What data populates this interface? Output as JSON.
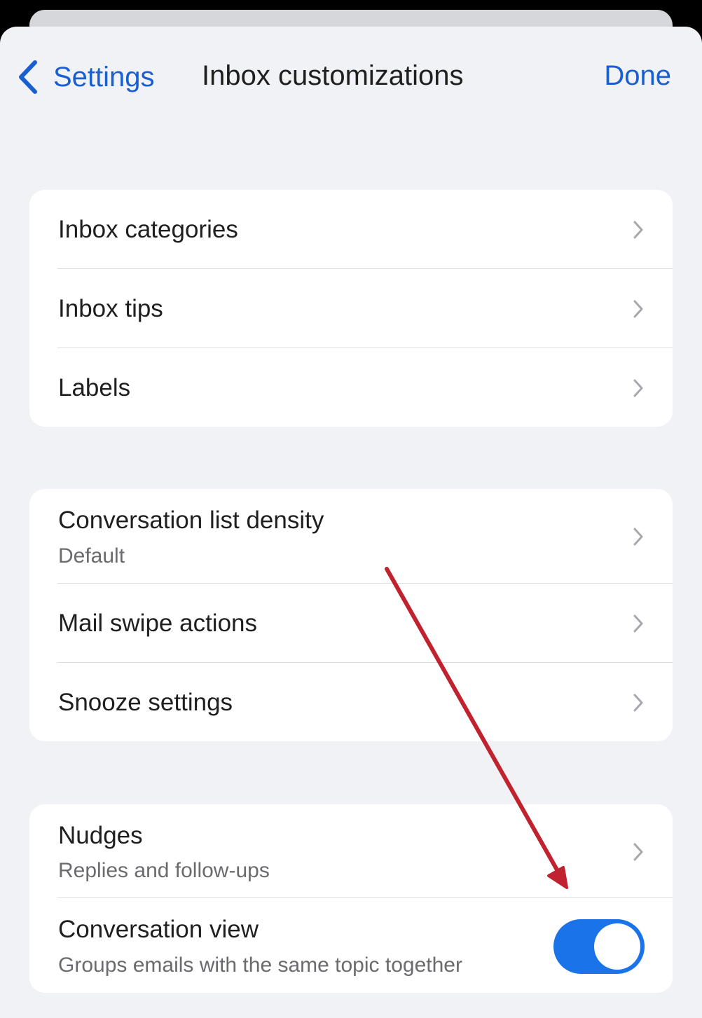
{
  "nav": {
    "back_label": "Settings",
    "title": "Inbox customizations",
    "done_label": "Done"
  },
  "groups": [
    {
      "items": [
        {
          "title": "Inbox categories"
        },
        {
          "title": "Inbox tips"
        },
        {
          "title": "Labels"
        }
      ]
    },
    {
      "items": [
        {
          "title": "Conversation list density",
          "subtitle": "Default"
        },
        {
          "title": "Mail swipe actions"
        },
        {
          "title": "Snooze settings"
        }
      ]
    },
    {
      "items": [
        {
          "title": "Nudges",
          "subtitle": "Replies and follow-ups"
        },
        {
          "title": "Conversation view",
          "subtitle": "Groups emails with the same topic together",
          "toggle_on": true
        }
      ]
    }
  ],
  "colors": {
    "accent": "#1a73e8",
    "link": "#1a5fd0",
    "annotation_arrow": "#c0232f"
  },
  "icons": {
    "back": "chevron-left-icon",
    "row": "chevron-right-icon"
  }
}
